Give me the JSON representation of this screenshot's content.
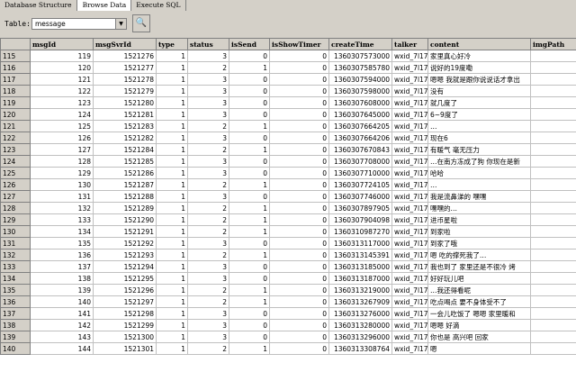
{
  "tabs": [
    {
      "label": "Database Structure"
    },
    {
      "label": "Browse Data"
    },
    {
      "label": "Execute SQL"
    }
  ],
  "toolbar": {
    "table_label": "Table:",
    "table_value": "message",
    "dropdown_icon": "chevron-down-icon",
    "find_icon": "magnifier-icon"
  },
  "grid": {
    "columns": [
      "",
      "msgId",
      "msgSvrId",
      "type",
      "status",
      "isSend",
      "isShowTimer",
      "createTime",
      "talker",
      "content",
      "imgPath"
    ],
    "rows": [
      [
        "115",
        "119",
        "1521276",
        "1",
        "3",
        "0",
        "0",
        "1360307573000",
        "wxid_7l17",
        "家里真心好冷",
        ""
      ],
      [
        "116",
        "120",
        "1521277",
        "1",
        "2",
        "1",
        "0",
        "1360307585780",
        "wxid_7l17",
        "说好的19度嘞",
        ""
      ],
      [
        "117",
        "121",
        "1521278",
        "1",
        "3",
        "0",
        "0",
        "1360307594000",
        "wxid_7l17",
        "嗯嗯 我就是跟你说说话才拿出",
        ""
      ],
      [
        "118",
        "122",
        "1521279",
        "1",
        "3",
        "0",
        "0",
        "1360307598000",
        "wxid_7l17",
        "没有",
        ""
      ],
      [
        "119",
        "123",
        "1521280",
        "1",
        "3",
        "0",
        "0",
        "1360307608000",
        "wxid_7l17",
        "就几度了",
        ""
      ],
      [
        "120",
        "124",
        "1521281",
        "1",
        "3",
        "0",
        "0",
        "1360307645000",
        "wxid_7l17",
        "6~9度了",
        ""
      ],
      [
        "121",
        "125",
        "1521283",
        "1",
        "2",
        "1",
        "0",
        "1360307664205",
        "wxid_7l17",
        "…",
        ""
      ],
      [
        "122",
        "126",
        "1521282",
        "1",
        "3",
        "0",
        "0",
        "1360307664206",
        "wxid_7l17",
        "现在6",
        ""
      ],
      [
        "123",
        "127",
        "1521284",
        "1",
        "2",
        "1",
        "0",
        "1360307670843",
        "wxid_7l17",
        "有暖气 毫无压力",
        ""
      ],
      [
        "124",
        "128",
        "1521285",
        "1",
        "3",
        "0",
        "0",
        "1360307708000",
        "wxid_7l17",
        "…在南方冻成了狗 你现在是新",
        ""
      ],
      [
        "125",
        "129",
        "1521286",
        "1",
        "3",
        "0",
        "0",
        "1360307710000",
        "wxid_7l17",
        "哈哈",
        ""
      ],
      [
        "126",
        "130",
        "1521287",
        "1",
        "2",
        "1",
        "0",
        "1360307724105",
        "wxid_7l17",
        "…",
        ""
      ],
      [
        "127",
        "131",
        "1521288",
        "1",
        "3",
        "0",
        "0",
        "1360307746000",
        "wxid_7l17",
        "我是流鼻涕的 嘿嘿",
        ""
      ],
      [
        "128",
        "132",
        "1521289",
        "1",
        "2",
        "1",
        "0",
        "1360307897905",
        "wxid_7l17",
        "嘿嘿的…",
        ""
      ],
      [
        "129",
        "133",
        "1521290",
        "1",
        "2",
        "1",
        "0",
        "1360307904098",
        "wxid_7l17",
        "进币星啦",
        ""
      ],
      [
        "130",
        "134",
        "1521291",
        "1",
        "2",
        "1",
        "0",
        "1360310987270",
        "wxid_7l17",
        "到家啦",
        ""
      ],
      [
        "131",
        "135",
        "1521292",
        "1",
        "3",
        "0",
        "0",
        "1360313117000",
        "wxid_7l17",
        "到家了哦",
        ""
      ],
      [
        "132",
        "136",
        "1521293",
        "1",
        "2",
        "1",
        "0",
        "1360313145391",
        "wxid_7l17",
        "嗯 吃的撑死我了…",
        ""
      ],
      [
        "133",
        "137",
        "1521294",
        "1",
        "3",
        "0",
        "0",
        "1360313185000",
        "wxid_7l17",
        "我也到了 家里还是不很冷 烤",
        ""
      ],
      [
        "134",
        "138",
        "1521295",
        "1",
        "3",
        "0",
        "0",
        "1360313187000",
        "wxid_7l17",
        "好好玩儿吧",
        ""
      ],
      [
        "135",
        "139",
        "1521296",
        "1",
        "2",
        "1",
        "0",
        "1360313219000",
        "wxid_7l17",
        "…我还得看呢",
        ""
      ],
      [
        "136",
        "140",
        "1521297",
        "1",
        "2",
        "1",
        "0",
        "1360313267909",
        "wxid_7l17",
        "吃点喝点 要不身体受不了",
        ""
      ],
      [
        "137",
        "141",
        "1521298",
        "1",
        "3",
        "0",
        "0",
        "1360313276000",
        "wxid_7l17",
        "一会儿吃饭了 嗯嗯 家里暖和",
        ""
      ],
      [
        "138",
        "142",
        "1521299",
        "1",
        "3",
        "0",
        "0",
        "1360313280000",
        "wxid_7l17",
        "嗯嗯 好滴",
        ""
      ],
      [
        "139",
        "143",
        "1521300",
        "1",
        "3",
        "0",
        "0",
        "1360313296000",
        "wxid_7l17",
        "你也是 高兴吧 回家",
        ""
      ],
      [
        "140",
        "144",
        "1521301",
        "1",
        "2",
        "1",
        "0",
        "1360313308764",
        "wxid_7l17",
        "嗯",
        ""
      ]
    ]
  }
}
